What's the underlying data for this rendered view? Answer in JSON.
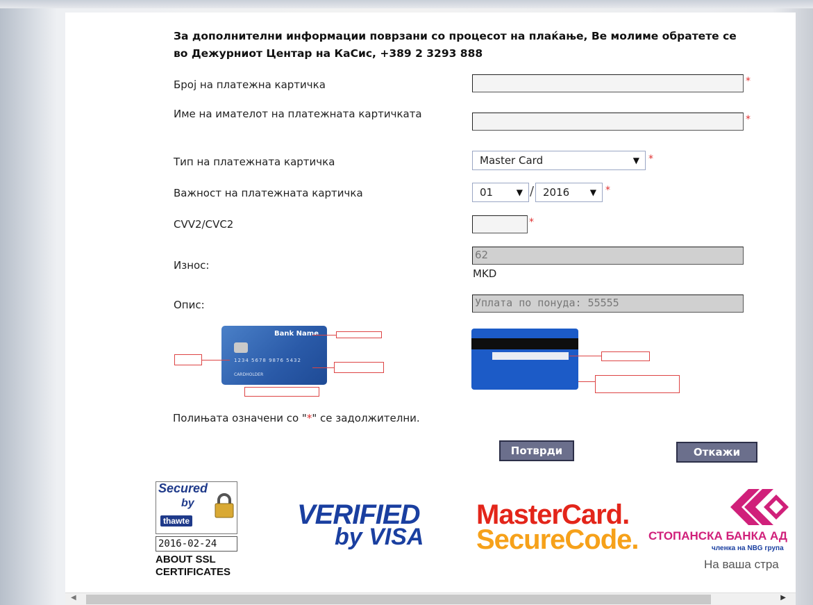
{
  "info_text": "За дополнителни информации поврзани со процесот на плаќање, Ве молиме обратете се во Дежурниот Центар на КаСис, +389 2 3293 888",
  "form": {
    "card_number_label": "Број на платежна картичка",
    "card_number_value": "",
    "holder_label": "Име на имателот на платежната картичката",
    "holder_value": "",
    "card_type_label": "Тип на платежната картичка",
    "card_type_selected": "Master Card",
    "expiry_label": "Важност на платежната картичка",
    "expiry_month": "01",
    "expiry_year": "2016",
    "expiry_separator": "/",
    "cvv_label": "CVV2/CVC2",
    "cvv_value": "",
    "amount_label": "Износ:",
    "amount_value": "62",
    "currency": "MKD",
    "description_label": "Опис:",
    "description_value": "Уплата по понуда: 55555",
    "required_marker": "*"
  },
  "card_front": {
    "bank_name": "Bank Name",
    "number": "1234 5678 9876 5432",
    "holder": "CARDHOLDER"
  },
  "required_note": {
    "before": "Полињата означени со \"",
    "star": "*",
    "after": "\" се задолжителни."
  },
  "buttons": {
    "confirm": "Потврди",
    "cancel": "Откажи"
  },
  "logos": {
    "thawte_line1": "Secured",
    "thawte_line2": "by",
    "thawte_brand": "thawte",
    "thawte_date": "2016-02-24",
    "about_ssl": "ABOUT SSL CERTIFICATES",
    "visa_line1": "VERIFIED",
    "visa_line2": "by VISA",
    "mc_line1": "MasterCard.",
    "mc_line2": "SecureCode.",
    "bank_name": "СТОПАНСКА БАНКА АД",
    "bank_sub": "членка на NBG група",
    "bank_slogan": "На ваша стра"
  },
  "colors": {
    "required": "#e03030",
    "button_bg": "#6b6f8c",
    "visa_blue": "#1a3fa0",
    "mc_red": "#e3251a",
    "mc_orange": "#f6a11a",
    "bank_magenta": "#d0207a"
  }
}
